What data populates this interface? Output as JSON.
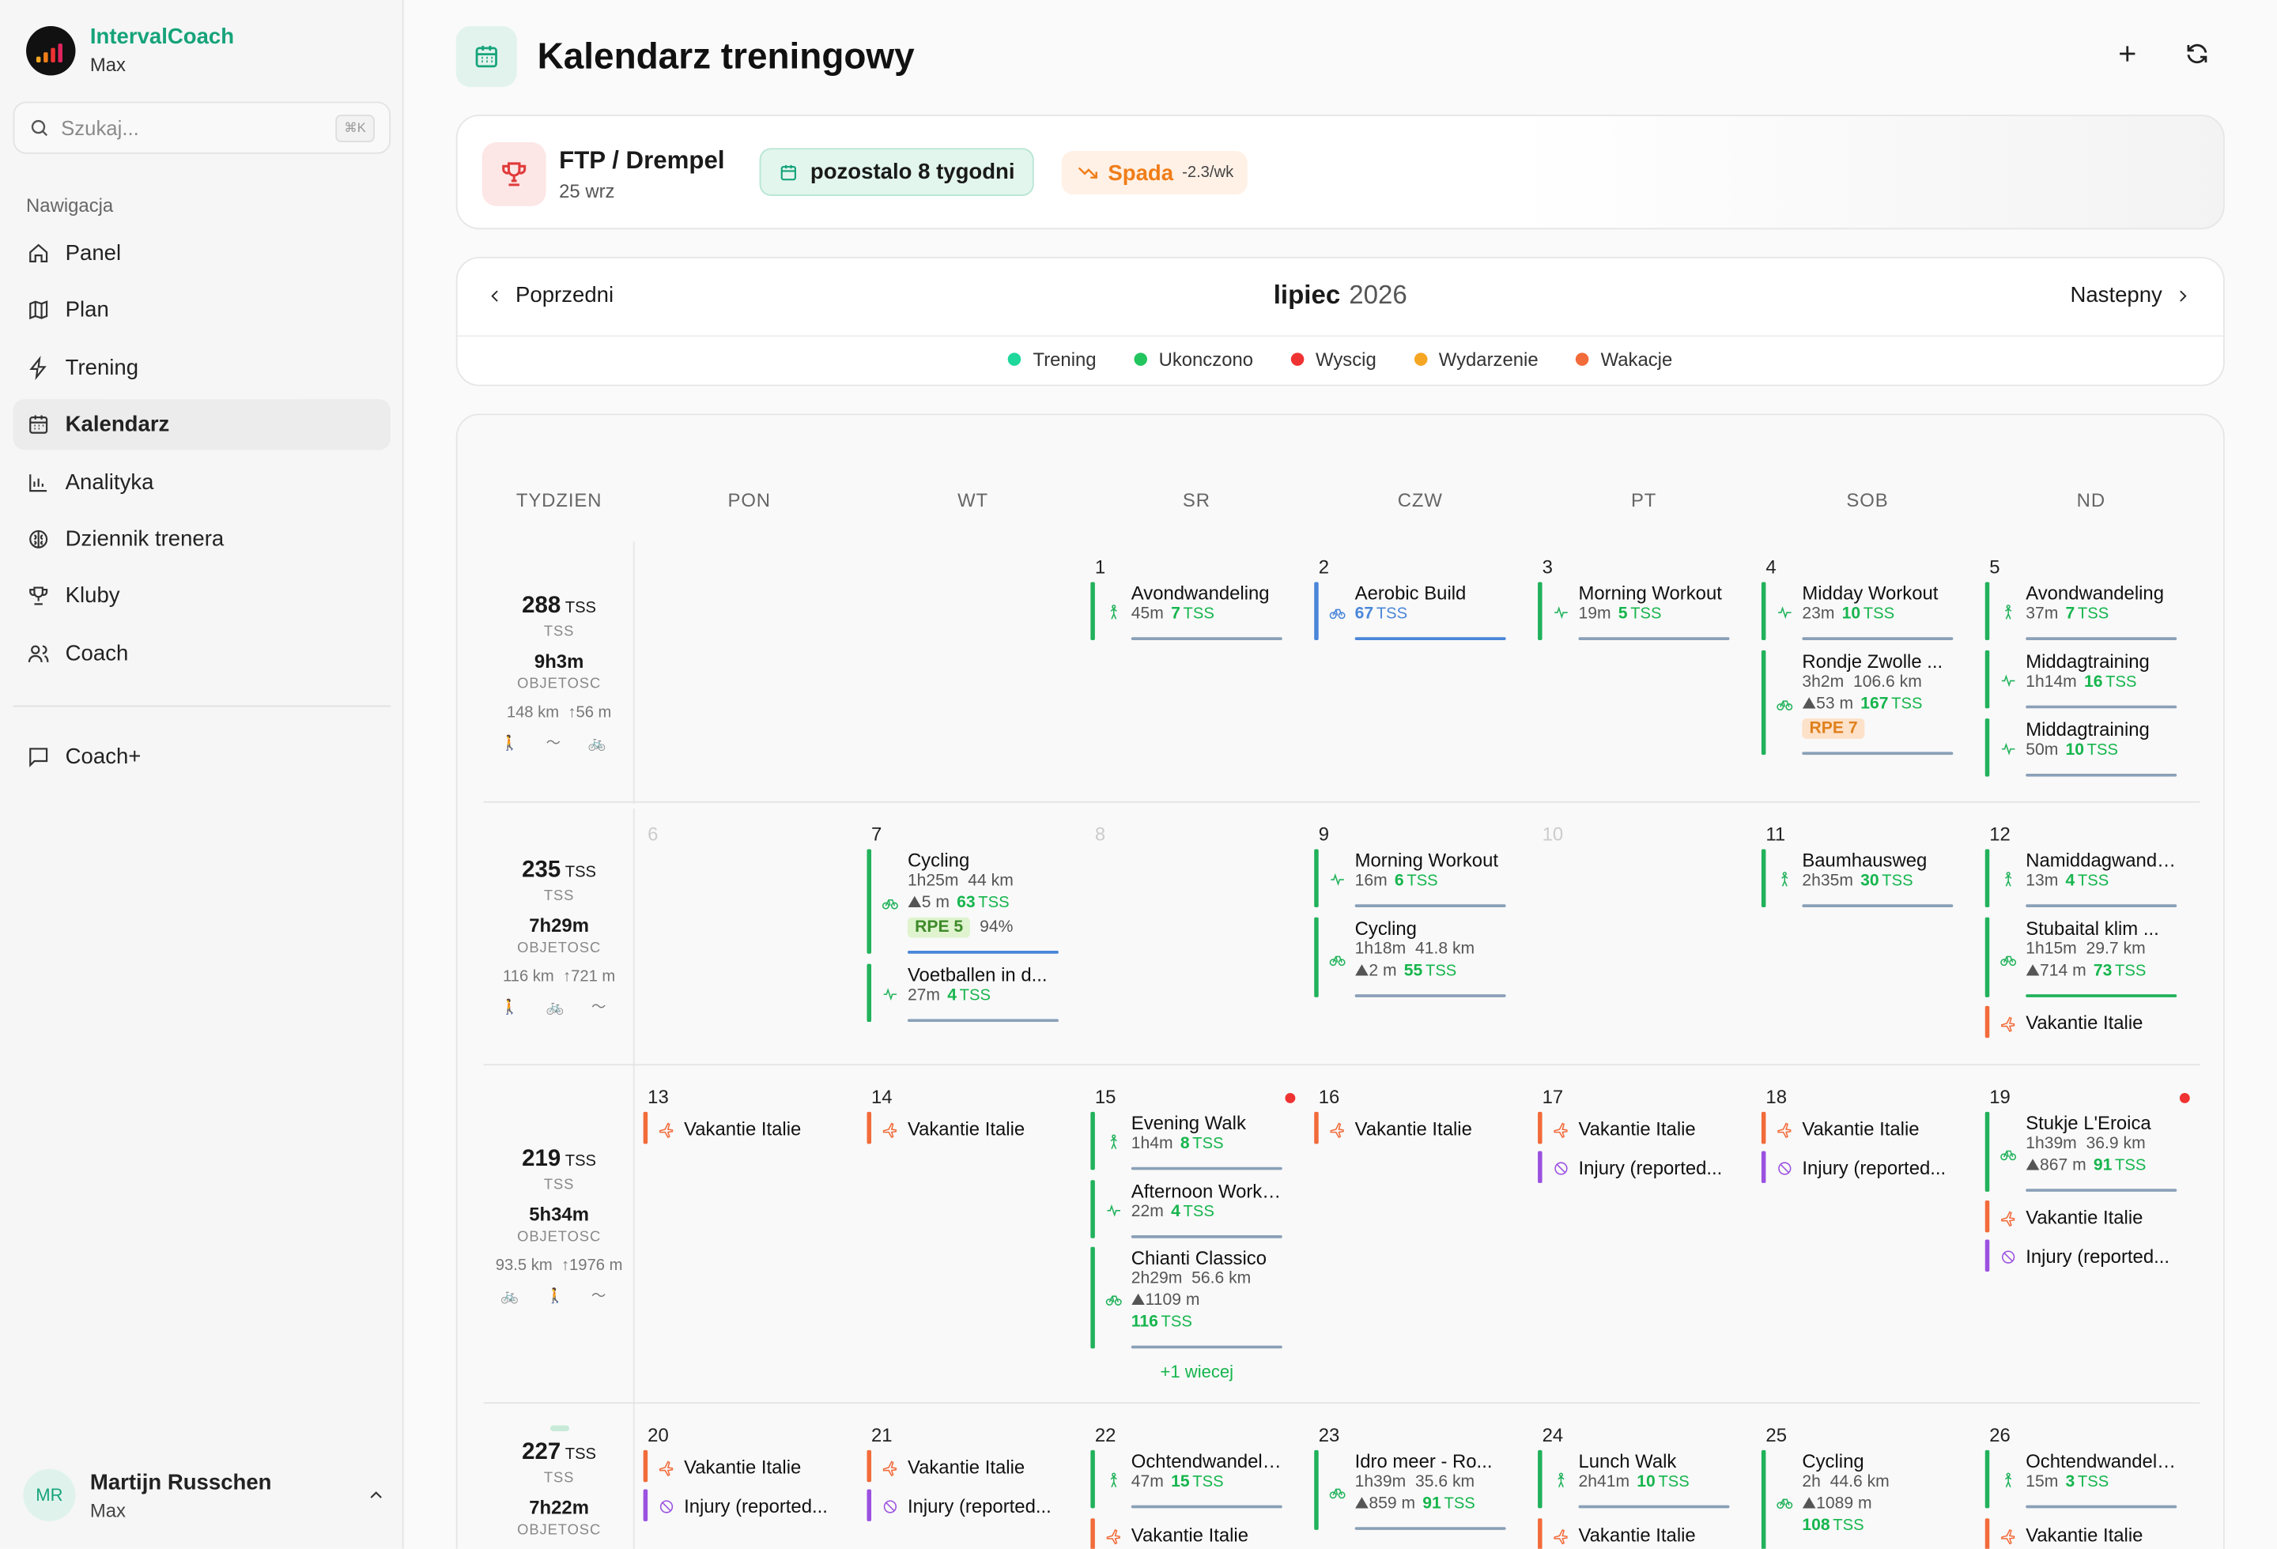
{
  "app": {
    "name": "IntervalCoach",
    "sub": "Max"
  },
  "search": {
    "placeholder": "Szukaj...",
    "shortcut": "⌘K"
  },
  "nav": {
    "title": "Nawigacja",
    "items": [
      {
        "label": "Panel",
        "icon": "home-icon"
      },
      {
        "label": "Plan",
        "icon": "map-icon"
      },
      {
        "label": "Trening",
        "icon": "zap-icon"
      },
      {
        "label": "Kalendarz",
        "icon": "calendar-icon",
        "active": true
      },
      {
        "label": "Analityka",
        "icon": "chart-icon"
      },
      {
        "label": "Dziennik trenera",
        "icon": "brain-icon"
      },
      {
        "label": "Kluby",
        "icon": "trophy-icon"
      },
      {
        "label": "Coach",
        "icon": "users-icon"
      }
    ],
    "coachplus": "Coach+"
  },
  "user": {
    "name": "Martijn Russchen",
    "sub": "Max",
    "initials": "MR"
  },
  "page": {
    "title": "Kalendarz treningowy"
  },
  "goal": {
    "title": "FTP / Drempel",
    "date": "25 wrz",
    "weeks": "pozostalo 8 tygodni",
    "trend": "Spada",
    "trend_rate": "-2.3/wk"
  },
  "month": {
    "prev": "Poprzedni",
    "next": "Nastepny",
    "name": "lipiec",
    "year": "2026"
  },
  "legend": [
    {
      "label": "Trening",
      "color": "#1ed79a"
    },
    {
      "label": "Ukonczono",
      "color": "#22c55e"
    },
    {
      "label": "Wyscig",
      "color": "#ef3232"
    },
    {
      "label": "Wydarzenie",
      "color": "#f5a623"
    },
    {
      "label": "Wakacje",
      "color": "#f26b3a"
    }
  ],
  "headers": [
    "TYDZIEN",
    "PON",
    "WT",
    "SR",
    "CZW",
    "PT",
    "SOB",
    "ND"
  ],
  "weeks": [
    {
      "tss": "288",
      "tss_unit": "TSS",
      "tss_lbl": "TSS",
      "dur": "9h3m",
      "dur_lbl": "OBJETOSC",
      "km": "148 km",
      "elev": "↑56 m",
      "icons": "🚶 〜 🚲"
    },
    {
      "tss": "235",
      "tss_unit": "TSS",
      "tss_lbl": "TSS",
      "dur": "7h29m",
      "dur_lbl": "OBJETOSC",
      "km": "116 km",
      "elev": "↑721 m",
      "icons": "🚶 🚲 〜"
    },
    {
      "tss": "219",
      "tss_unit": "TSS",
      "tss_lbl": "TSS",
      "dur": "5h34m",
      "dur_lbl": "OBJETOSC",
      "km": "93.5 km",
      "elev": "↑1976 m",
      "icons": "🚲 🚶 〜"
    },
    {
      "tss": "227",
      "tss_unit": "TSS",
      "tss_lbl": "TSS",
      "dur": "7h22m",
      "dur_lbl": "OBJETOSC"
    }
  ],
  "days": [
    {
      "n": "1",
      "w": 0,
      "d": 2
    },
    {
      "n": "2",
      "w": 0,
      "d": 3
    },
    {
      "n": "3",
      "w": 0,
      "d": 4
    },
    {
      "n": "4",
      "w": 0,
      "d": 5
    },
    {
      "n": "5",
      "w": 0,
      "d": 6
    },
    {
      "n": "6",
      "w": 1,
      "d": 0,
      "dim": true
    },
    {
      "n": "7",
      "w": 1,
      "d": 1
    },
    {
      "n": "8",
      "w": 1,
      "d": 2,
      "dim": true
    },
    {
      "n": "9",
      "w": 1,
      "d": 3
    },
    {
      "n": "10",
      "w": 1,
      "d": 4,
      "dim": true
    },
    {
      "n": "11",
      "w": 1,
      "d": 5
    },
    {
      "n": "12",
      "w": 1,
      "d": 6
    },
    {
      "n": "13",
      "w": 2,
      "d": 0
    },
    {
      "n": "14",
      "w": 2,
      "d": 1
    },
    {
      "n": "15",
      "w": 2,
      "d": 2
    },
    {
      "n": "16",
      "w": 2,
      "d": 3
    },
    {
      "n": "17",
      "w": 2,
      "d": 4
    },
    {
      "n": "18",
      "w": 2,
      "d": 5
    },
    {
      "n": "19",
      "w": 2,
      "d": 6
    },
    {
      "n": "20",
      "w": 3,
      "d": 0
    },
    {
      "n": "21",
      "w": 3,
      "d": 1
    },
    {
      "n": "22",
      "w": 3,
      "d": 2
    },
    {
      "n": "23",
      "w": 3,
      "d": 3
    },
    {
      "n": "24",
      "w": 3,
      "d": 4
    },
    {
      "n": "25",
      "w": 3,
      "d": 5
    },
    {
      "n": "26",
      "w": 3,
      "d": 6
    }
  ],
  "activities": [
    {
      "w": 0,
      "d": 2,
      "t": 0,
      "title": "Avondwandeling",
      "dur": "45m",
      "tss": "7",
      "type": "walk"
    },
    {
      "w": 0,
      "d": 3,
      "t": 0,
      "title": "Aerobic Build",
      "tss": "67",
      "type": "bike",
      "planned": true
    },
    {
      "w": 0,
      "d": 4,
      "t": 0,
      "title": "Morning Workout",
      "dur": "19m",
      "tss": "5",
      "type": "other"
    },
    {
      "w": 0,
      "d": 5,
      "t": 0,
      "title": "Midday Workout",
      "dur": "23m",
      "tss": "10",
      "type": "other"
    },
    {
      "w": 0,
      "d": 5,
      "t": 47,
      "title": "Rondje Zwolle ...",
      "dur": "3h2m",
      "dist": "106.6 km",
      "elev": "53 m",
      "tss": "167",
      "rpe": "RPE 7",
      "rpe_c": "o",
      "type": "bike"
    },
    {
      "w": 0,
      "d": 6,
      "t": 0,
      "title": "Avondwandeling",
      "dur": "37m",
      "tss": "7",
      "type": "walk"
    },
    {
      "w": 0,
      "d": 6,
      "t": 47,
      "title": "Middagtraining",
      "dur": "1h14m",
      "tss": "16",
      "type": "other"
    },
    {
      "w": 0,
      "d": 6,
      "t": 94,
      "title": "Middagtraining",
      "dur": "50m",
      "tss": "10",
      "type": "other"
    },
    {
      "w": 1,
      "d": 1,
      "t": 0,
      "title": "Cycling",
      "dur": "1h25m",
      "dist": "44 km",
      "elev": "5 m",
      "tss": "63",
      "rpe": "RPE 5",
      "rpe_c": "g",
      "pct": "94%",
      "type": "bike",
      "line": "blue2"
    },
    {
      "w": 1,
      "d": 1,
      "t": 79,
      "title": "Voetballen in d...",
      "dur": "27m",
      "tss": "4",
      "type": "other"
    },
    {
      "w": 1,
      "d": 3,
      "t": 0,
      "title": "Morning Workout",
      "dur": "16m",
      "tss": "6",
      "type": "other"
    },
    {
      "w": 1,
      "d": 3,
      "t": 47,
      "title": "Cycling",
      "dur": "1h18m",
      "dist": "41.8 km",
      "elev": "2 m",
      "tss": "55",
      "type": "bike"
    },
    {
      "w": 1,
      "d": 5,
      "t": 0,
      "title": "Baumhausweg",
      "dur": "2h35m",
      "tss": "30",
      "type": "walk"
    },
    {
      "w": 1,
      "d": 6,
      "t": 0,
      "title": "Namiddagwandeling",
      "dur": "13m",
      "tss": "4",
      "type": "walk"
    },
    {
      "w": 1,
      "d": 6,
      "t": 47,
      "title": "Stubaital klim ...",
      "dur": "1h15m",
      "dist": "29.7 km",
      "elev": "714 m",
      "tss": "73",
      "type": "bike",
      "line": "green"
    },
    {
      "w": 1,
      "d": 6,
      "t": 108,
      "title": "Vakantie Italie",
      "type": "vac"
    },
    {
      "w": 2,
      "d": 0,
      "t": 0,
      "title": "Vakantie Italie",
      "type": "vac"
    },
    {
      "w": 2,
      "d": 1,
      "t": 0,
      "title": "Vakantie Italie",
      "type": "vac"
    },
    {
      "w": 2,
      "d": 2,
      "t": 0,
      "title": "Evening Walk",
      "dur": "1h4m",
      "tss": "8",
      "type": "walk"
    },
    {
      "w": 2,
      "d": 2,
      "t": 47,
      "title": "Afternoon Workout",
      "dur": "22m",
      "tss": "4",
      "type": "other"
    },
    {
      "w": 2,
      "d": 2,
      "t": 93,
      "title": "Chianti Classico",
      "dur": "2h29m",
      "dist": "56.6 km",
      "elev": "1109 m",
      "tss": "116",
      "type": "bike",
      "tssbreak": true
    },
    {
      "w": 2,
      "d": 3,
      "t": 0,
      "title": "Vakantie Italie",
      "type": "vac"
    },
    {
      "w": 2,
      "d": 4,
      "t": 0,
      "title": "Vakantie Italie",
      "type": "vac"
    },
    {
      "w": 2,
      "d": 4,
      "t": 27,
      "title": "Injury (reported...",
      "type": "inj"
    },
    {
      "w": 2,
      "d": 5,
      "t": 0,
      "title": "Vakantie Italie",
      "type": "vac"
    },
    {
      "w": 2,
      "d": 5,
      "t": 27,
      "title": "Injury (reported...",
      "type": "inj"
    },
    {
      "w": 2,
      "d": 6,
      "t": 0,
      "title": "Stukje L'Eroica",
      "dur": "1h39m",
      "dist": "36.9 km",
      "elev": "867 m",
      "tss": "91",
      "type": "bike"
    },
    {
      "w": 2,
      "d": 6,
      "t": 61,
      "title": "Vakantie Italie",
      "type": "vac"
    },
    {
      "w": 2,
      "d": 6,
      "t": 88,
      "title": "Injury (reported...",
      "type": "inj"
    },
    {
      "w": 3,
      "d": 0,
      "t": 0,
      "title": "Vakantie Italie",
      "type": "vac"
    },
    {
      "w": 3,
      "d": 0,
      "t": 27,
      "title": "Injury (reported...",
      "type": "inj"
    },
    {
      "w": 3,
      "d": 1,
      "t": 0,
      "title": "Vakantie Italie",
      "type": "vac"
    },
    {
      "w": 3,
      "d": 1,
      "t": 27,
      "title": "Injury (reported...",
      "type": "inj"
    },
    {
      "w": 3,
      "d": 2,
      "t": 0,
      "title": "Ochtendwandeling",
      "dur": "47m",
      "tss": "15",
      "type": "walk"
    },
    {
      "w": 3,
      "d": 2,
      "t": 47,
      "title": "Vakantie Italie",
      "type": "vac"
    },
    {
      "w": 3,
      "d": 3,
      "t": 0,
      "title": "Idro meer - Ro...",
      "dur": "1h39m",
      "dist": "35.6 km",
      "elev": "859 m",
      "tss": "91",
      "type": "bike"
    },
    {
      "w": 3,
      "d": 4,
      "t": 0,
      "title": "Lunch Walk",
      "dur": "2h41m",
      "tss": "10",
      "type": "walk"
    },
    {
      "w": 3,
      "d": 4,
      "t": 47,
      "title": "Vakantie Italie",
      "type": "vac"
    },
    {
      "w": 3,
      "d": 5,
      "t": 0,
      "title": "Cycling",
      "dur": "2h",
      "dist": "44.6 km",
      "elev": "1089 m",
      "tss": "108",
      "type": "bike",
      "tssbreak": true
    },
    {
      "w": 3,
      "d": 6,
      "t": 0,
      "title": "Ochtendwandeling",
      "dur": "15m",
      "tss": "3",
      "type": "walk"
    },
    {
      "w": 3,
      "d": 6,
      "t": 47,
      "title": "Vakantie Italie",
      "type": "vac"
    }
  ],
  "more": {
    "label": "+1 wiecej"
  },
  "races": [
    {
      "w": 2,
      "d": 2
    },
    {
      "w": 2,
      "d": 6
    }
  ]
}
